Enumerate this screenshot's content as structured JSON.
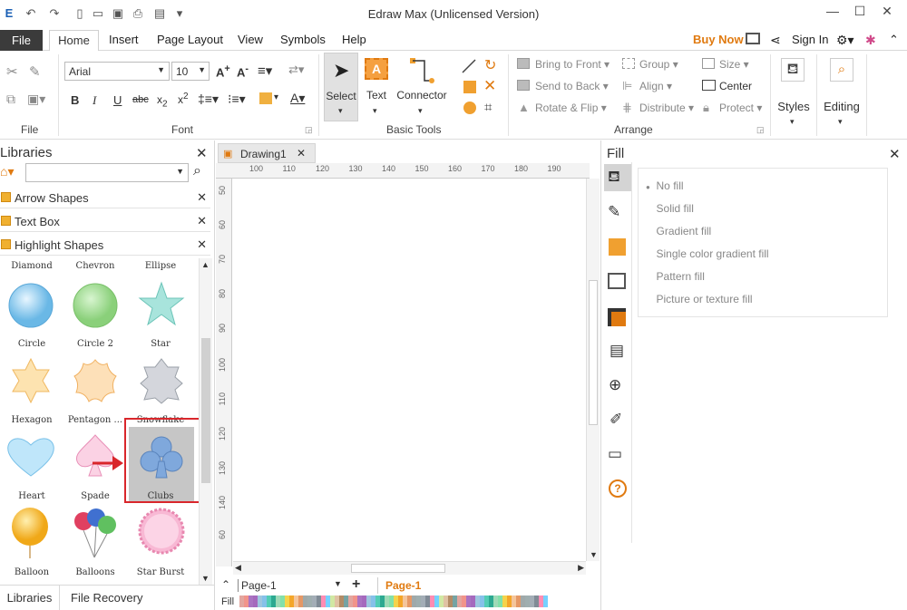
{
  "app": {
    "title": "Edraw Max (Unlicensed Version)"
  },
  "menu": {
    "file": "File",
    "tabs": [
      "Home",
      "Insert",
      "Page Layout",
      "View",
      "Symbols",
      "Help"
    ],
    "buy_now": "Buy Now",
    "sign_in": "Sign In"
  },
  "ribbon": {
    "file_group": "File",
    "font_group": "Font",
    "font_name": "Arial",
    "font_size": "10",
    "basic_tools_group": "Basic Tools",
    "select": "Select",
    "text": "Text",
    "connector": "Connector",
    "arrange_group": "Arrange",
    "bring_to_front": "Bring to Front",
    "send_to_back": "Send to Back",
    "rotate_flip": "Rotate & Flip",
    "group": "Group",
    "align": "Align",
    "distribute": "Distribute",
    "size": "Size",
    "center": "Center",
    "protect": "Protect",
    "styles": "Styles",
    "editing": "Editing"
  },
  "libraries": {
    "title": "Libraries",
    "search_placeholder": "",
    "sections": [
      "Arrow Shapes",
      "Text Box",
      "Highlight Shapes"
    ],
    "top_labels": [
      "Diamond",
      "Chevron",
      "Ellipse"
    ],
    "shapes": [
      {
        "label": "Circle",
        "icon": "circle-icon"
      },
      {
        "label": "Circle 2",
        "icon": "circle-2-icon"
      },
      {
        "label": "Star",
        "icon": "star-icon"
      },
      {
        "label": "Hexagon",
        "icon": "hexagon-icon"
      },
      {
        "label": "Pentagon ...",
        "icon": "pentagon-icon"
      },
      {
        "label": "Snowflake",
        "icon": "snowflake-icon"
      },
      {
        "label": "Heart",
        "icon": "heart-icon"
      },
      {
        "label": "Spade",
        "icon": "spade-icon"
      },
      {
        "label": "Clubs",
        "icon": "clubs-icon"
      },
      {
        "label": "Balloon",
        "icon": "balloon-icon"
      },
      {
        "label": "Balloons",
        "icon": "balloons-icon"
      },
      {
        "label": "Star Burst",
        "icon": "star-burst-icon"
      }
    ],
    "bottom_tabs": [
      "Libraries",
      "File Recovery"
    ]
  },
  "document": {
    "tab": "Drawing1",
    "ruler_h": [
      "100",
      "110",
      "120",
      "130",
      "140",
      "150",
      "160",
      "170",
      "180",
      "190"
    ],
    "ruler_v": [
      "50",
      "60",
      "70",
      "80",
      "90",
      "100",
      "110",
      "120",
      "130",
      "140",
      "60"
    ],
    "page_select": "Page-1",
    "page_tab": "Page-1",
    "fill_label": "Fill"
  },
  "fill_panel": {
    "title": "Fill",
    "options": [
      "No fill",
      "Solid fill",
      "Gradient fill",
      "Single color gradient fill",
      "Pattern fill",
      "Picture or texture fill"
    ],
    "selected": "No fill"
  },
  "colors": {
    "accent_orange": "#f0a030",
    "highlight_red": "#d9262b",
    "file_tab_bg": "#3b3b3b"
  }
}
